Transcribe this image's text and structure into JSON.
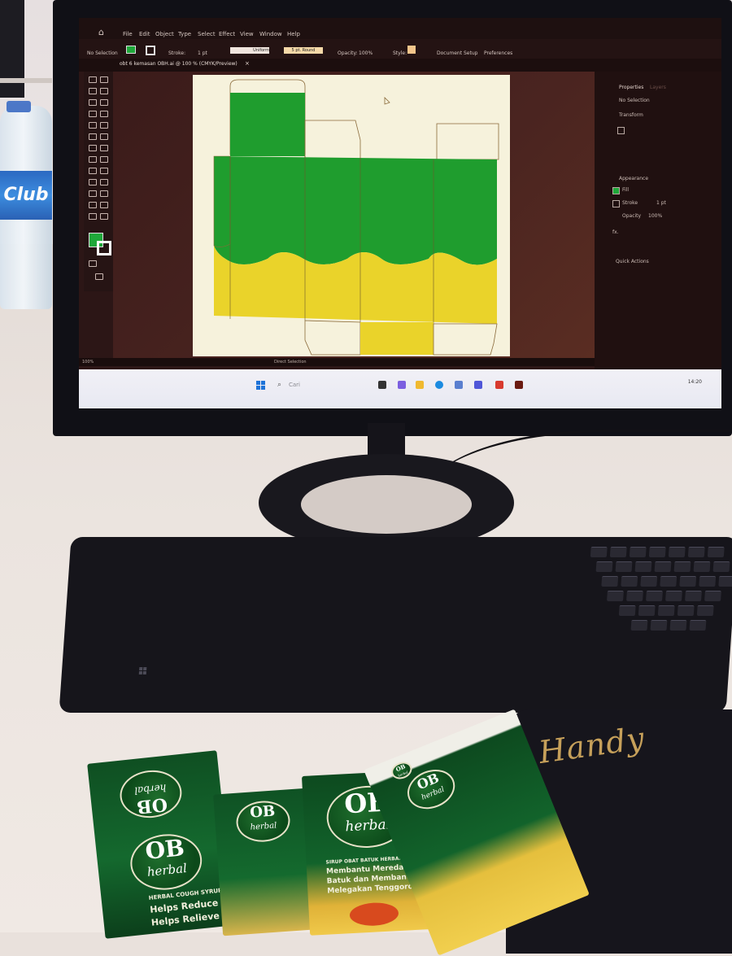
{
  "illustrator": {
    "menu": [
      "File",
      "Edit",
      "Object",
      "Type",
      "Select",
      "Effect",
      "View",
      "Window",
      "Help"
    ],
    "control_bar": {
      "no_selection": "No Selection",
      "stroke": "Stroke:",
      "stroke_weight": "1 pt",
      "profile": "Uniform",
      "brush": "5 pt. Round",
      "opacity_label": "Opacity:",
      "opacity_value": "100%",
      "style_label": "Style:",
      "document_setup": "Document Setup",
      "preferences": "Preferences"
    },
    "tab_title": "obt 6 kemasan OBH.ai @ 100 % (CMYK/Preview)",
    "tab_close": "×",
    "status": {
      "zoom": "100%",
      "tool": "Direct Selection"
    },
    "properties_panel": {
      "tabs": [
        "Properties",
        "Layers"
      ],
      "no_selection": "No Selection",
      "transform": "Transform",
      "appearance": "Appearance",
      "fill": "Fill",
      "stroke": "Stroke",
      "stroke_value": "1 pt",
      "opacity": "Opacity",
      "opacity_value": "100%",
      "fx": "fx.",
      "quick_actions": "Quick Actions"
    },
    "colors": {
      "fill": "#1fa83a",
      "dieline_green": "#1f9d2e",
      "dieline_yellow": "#ead32a"
    }
  },
  "taskbar": {
    "search_placeholder": "Cari",
    "time": "14:20"
  },
  "bottle_brand": "Club",
  "mousepad_brand": "Handy",
  "packaging": {
    "brand_ob": "OB",
    "brand_herbal": "herbal",
    "tagline_en_1": "HERBAL COUGH SYRUP",
    "tagline_en_2": "Helps Reduce Cough",
    "tagline_en_3": "Helps Relieve Throat",
    "tagline_id_1": "SIRUP OBAT BATUK HERBAL",
    "tagline_id_2": "Membantu Meredakan",
    "tagline_id_3": "Batuk dan Membantu",
    "tagline_id_4": "Melegakan Tenggorokan"
  }
}
